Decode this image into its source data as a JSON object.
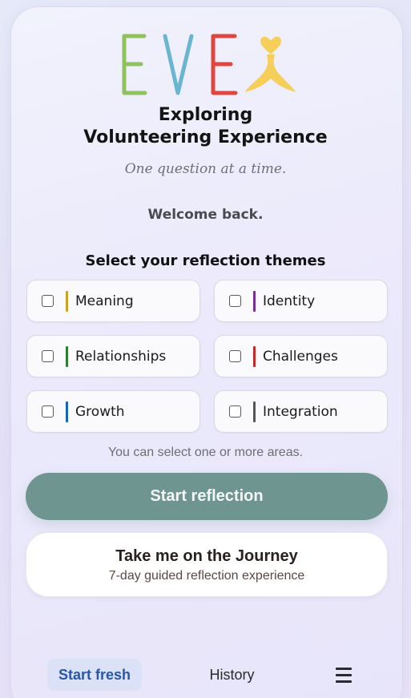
{
  "app": {
    "logo_text": "EVE",
    "title_line1": "Exploring",
    "title_line2": "Volunteering Experience",
    "tagline": "One question at a time.",
    "welcome": "Welcome back."
  },
  "themes": {
    "heading": "Select your reflection themes",
    "items": [
      {
        "label": "Meaning",
        "accent": "#c9a227",
        "checked": false
      },
      {
        "label": "Identity",
        "accent": "#7b2e91",
        "checked": false
      },
      {
        "label": "Relationships",
        "accent": "#2e7d32",
        "checked": false
      },
      {
        "label": "Challenges",
        "accent": "#c62828",
        "checked": false
      },
      {
        "label": "Growth",
        "accent": "#1565c0",
        "checked": false
      },
      {
        "label": "Integration",
        "accent": "#555555",
        "checked": false
      }
    ],
    "hint": "You can select one or more areas."
  },
  "actions": {
    "start_label": "Start reflection",
    "journey_title": "Take me on the Journey",
    "journey_subtitle": "7-day guided reflection experience"
  },
  "nav": {
    "start_fresh": "Start fresh",
    "history": "History",
    "menu_icon": "hamburger-menu-icon"
  },
  "colors": {
    "logo_e1": "#8fc25c",
    "logo_v": "#6ab5cf",
    "logo_e2": "#e0453f",
    "logo_figure": "#f5cf5a",
    "primary_button": "#6e958f",
    "nav_active_bg": "#dbe1f7",
    "nav_active_text": "#2857a8"
  }
}
